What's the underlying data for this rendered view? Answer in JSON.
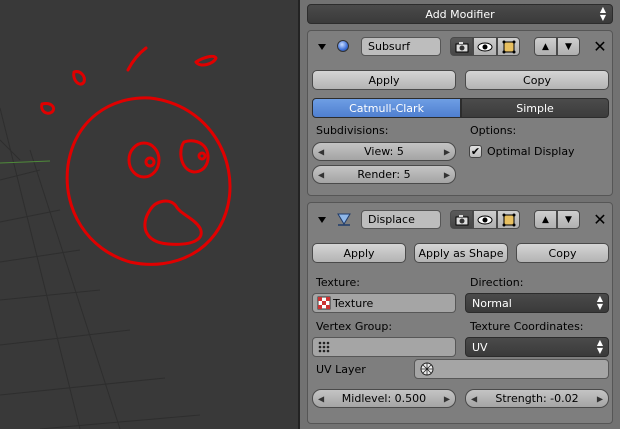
{
  "header": {
    "add_modifier_label": "Add Modifier"
  },
  "modifiers": [
    {
      "name": "Subsurf",
      "apply_label": "Apply",
      "copy_label": "Copy",
      "tabs": [
        "Catmull-Clark",
        "Simple"
      ],
      "active_tab": "Catmull-Clark",
      "subdivisions_label": "Subdivisions:",
      "view_field": "View: 5",
      "render_field": "Render: 5",
      "options_label": "Options:",
      "optimal_display_label": "Optimal Display",
      "optimal_display_checked": true
    },
    {
      "name": "Displace",
      "apply_label": "Apply",
      "apply_as_shape_label": "Apply as Shape",
      "copy_label": "Copy",
      "texture_label": "Texture:",
      "texture_value": "Texture",
      "direction_label": "Direction:",
      "direction_value": "Normal",
      "vertex_group_label": "Vertex Group:",
      "vertex_group_value": "",
      "texture_coordinates_label": "Texture Coordinates:",
      "texture_coordinates_value": "UV",
      "uv_layer_label": "UV Layer",
      "uv_layer_value": "",
      "midlevel_field": "Midlevel: 0.500",
      "strength_field": "Strength: -0.02"
    }
  ],
  "colors": {
    "annotation": "#e00000",
    "active_tab": "#5b8bd8",
    "viewport_bg": "#393939",
    "panel_bg": "#727272"
  }
}
